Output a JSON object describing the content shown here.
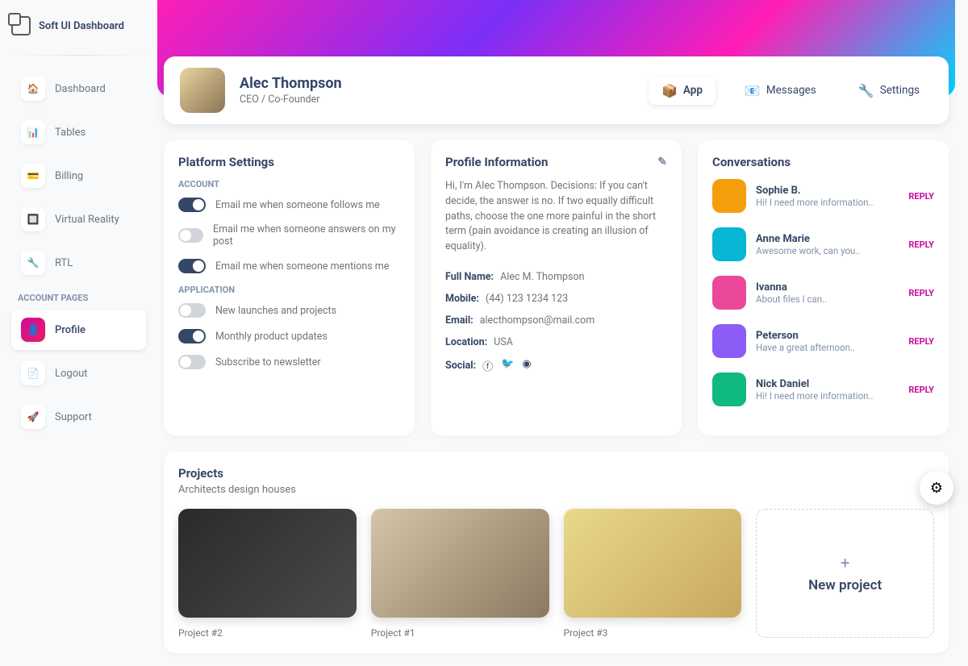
{
  "app": {
    "name": "Soft UI Dashboard"
  },
  "nav": {
    "items": [
      {
        "label": "Dashboard",
        "icon": "🏠"
      },
      {
        "label": "Tables",
        "icon": "📊"
      },
      {
        "label": "Billing",
        "icon": "💳"
      },
      {
        "label": "Virtual Reality",
        "icon": "🔲"
      },
      {
        "label": "RTL",
        "icon": "🔧"
      }
    ],
    "account_section": "ACCOUNT PAGES",
    "account_items": [
      {
        "label": "Profile",
        "icon": "👤"
      },
      {
        "label": "Logout",
        "icon": "📄"
      },
      {
        "label": "Support",
        "icon": "🚀"
      }
    ]
  },
  "profile": {
    "name": "Alec Thompson",
    "role": "CEO / Co-Founder",
    "tabs": [
      {
        "label": "App",
        "icon": "📦"
      },
      {
        "label": "Messages",
        "icon": "📧"
      },
      {
        "label": "Settings",
        "icon": "🔧"
      }
    ]
  },
  "platform": {
    "title": "Platform Settings",
    "account_label": "ACCOUNT",
    "application_label": "APPLICATION",
    "account_switches": [
      {
        "label": "Email me when someone follows me",
        "on": true
      },
      {
        "label": "Email me when someone answers on my post",
        "on": false
      },
      {
        "label": "Email me when someone mentions me",
        "on": true
      }
    ],
    "app_switches": [
      {
        "label": "New launches and projects",
        "on": false
      },
      {
        "label": "Monthly product updates",
        "on": true
      },
      {
        "label": "Subscribe to newsletter",
        "on": false
      }
    ]
  },
  "info": {
    "title": "Profile Information",
    "bio": "Hi, I'm Alec Thompson. Decisions: If you can't decide, the answer is no. If two equally difficult paths, choose the one more painful in the short term (pain avoidance is creating an illusion of equality).",
    "rows": {
      "name_k": "Full Name:",
      "name_v": "Alec M. Thompson",
      "mobile_k": "Mobile:",
      "mobile_v": "(44) 123 1234 123",
      "email_k": "Email:",
      "email_v": "alecthompson@mail.com",
      "location_k": "Location:",
      "location_v": "USA",
      "social_k": "Social:"
    }
  },
  "conversations": {
    "title": "Conversations",
    "reply": "REPLY",
    "items": [
      {
        "name": "Sophie B.",
        "msg": "Hi! I need more information..",
        "color": "#f59e0b"
      },
      {
        "name": "Anne Marie",
        "msg": "Awesome work, can you..",
        "color": "#06b6d4"
      },
      {
        "name": "Ivanna",
        "msg": "About files I can..",
        "color": "#ec4899"
      },
      {
        "name": "Peterson",
        "msg": "Have a great afternoon..",
        "color": "#8b5cf6"
      },
      {
        "name": "Nick Daniel",
        "msg": "Hi! I need more information..",
        "color": "#10b981"
      }
    ]
  },
  "projects": {
    "title": "Projects",
    "subtitle": "Architects design houses",
    "items": [
      {
        "label": "Project #2",
        "bg": "linear-gradient(135deg,#2a2a2a,#4a4a4a)"
      },
      {
        "label": "Project #1",
        "bg": "linear-gradient(135deg,#d4c5a8,#8a7960)"
      },
      {
        "label": "Project #3",
        "bg": "linear-gradient(135deg,#e8d88a,#c9a85f)"
      }
    ],
    "new_label": "New project"
  }
}
